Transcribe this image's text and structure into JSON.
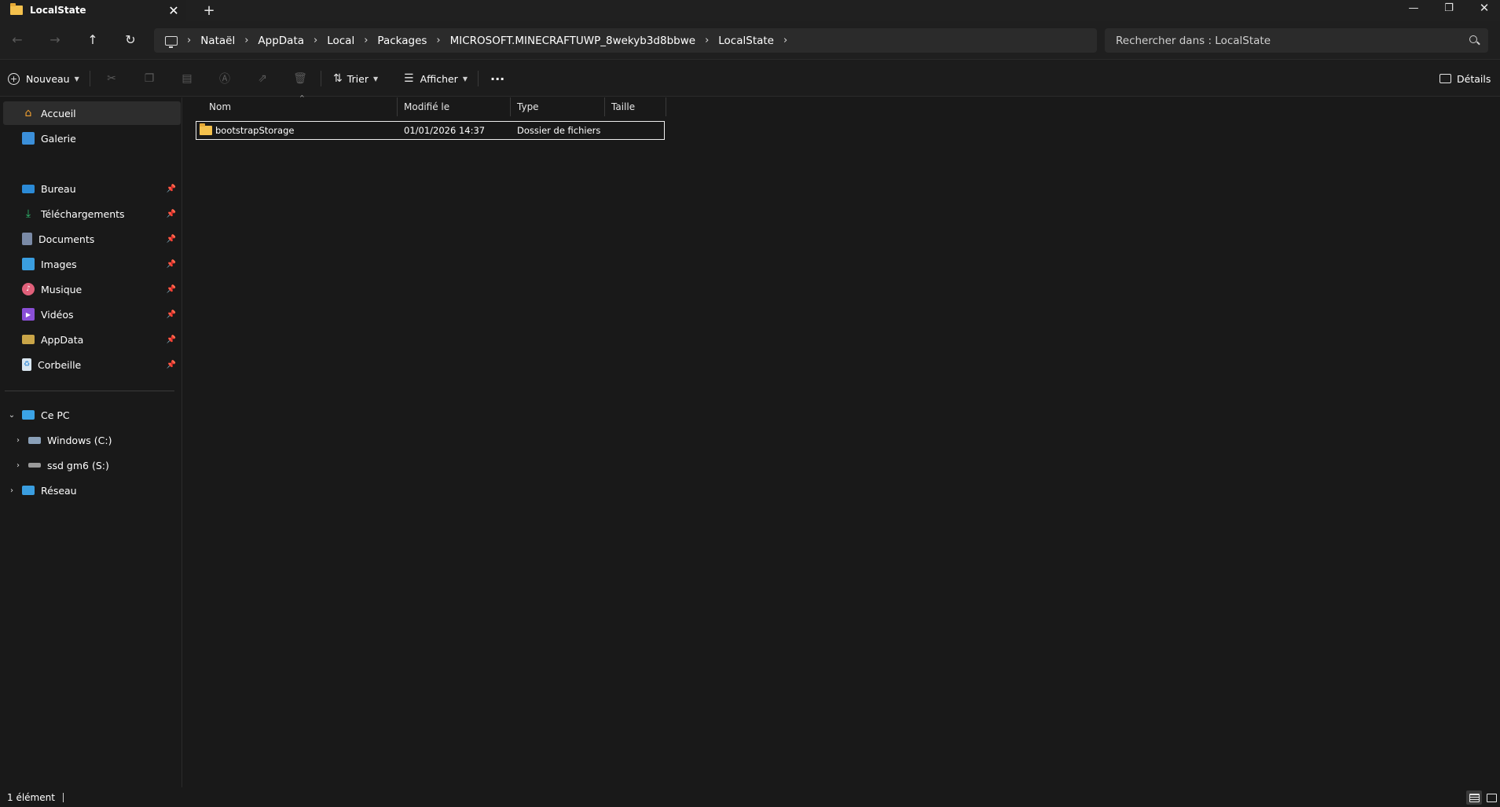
{
  "tab": {
    "title": "LocalState",
    "close": "✕",
    "new_tab": "+"
  },
  "window": {
    "minimize": "—",
    "maximize": "❐",
    "close": "✕"
  },
  "nav": {
    "back": "←",
    "forward": "→",
    "up": "↑",
    "refresh": "↻"
  },
  "breadcrumb": [
    "Nataël",
    "AppData",
    "Local",
    "Packages",
    "MICROSOFT.MINECRAFTUWP_8wekyb3d8bbwe",
    "LocalState"
  ],
  "search": {
    "placeholder": "Rechercher dans : LocalState"
  },
  "toolbar": {
    "new_label": "Nouveau",
    "sort_label": "Trier",
    "view_label": "Afficher",
    "more_label": "···",
    "details_label": "Détails"
  },
  "sidebar": {
    "top": [
      {
        "label": "Accueil",
        "icon": "home-icon"
      },
      {
        "label": "Galerie",
        "icon": "gallery-icon"
      }
    ],
    "quick": [
      {
        "label": "Bureau",
        "icon": "desktop-icon"
      },
      {
        "label": "Téléchargements",
        "icon": "download-icon"
      },
      {
        "label": "Documents",
        "icon": "document-icon"
      },
      {
        "label": "Images",
        "icon": "image-icon"
      },
      {
        "label": "Musique",
        "icon": "music-icon"
      },
      {
        "label": "Vidéos",
        "icon": "video-icon"
      },
      {
        "label": "AppData",
        "icon": "folder-icon"
      },
      {
        "label": "Corbeille",
        "icon": "recycle-bin-icon"
      }
    ],
    "pc": {
      "label": "Ce PC"
    },
    "drives": [
      {
        "label": "Windows (C:)"
      },
      {
        "label": "ssd gm6 (S:)"
      }
    ],
    "network": {
      "label": "Réseau"
    }
  },
  "columns": {
    "name": "Nom",
    "modified": "Modifié le",
    "type": "Type",
    "size": "Taille"
  },
  "files": [
    {
      "name": "bootstrapStorage",
      "modified": "01/01/2026 14:37",
      "type": "Dossier de fichiers",
      "size": ""
    }
  ],
  "status": {
    "count": "1 élément"
  }
}
